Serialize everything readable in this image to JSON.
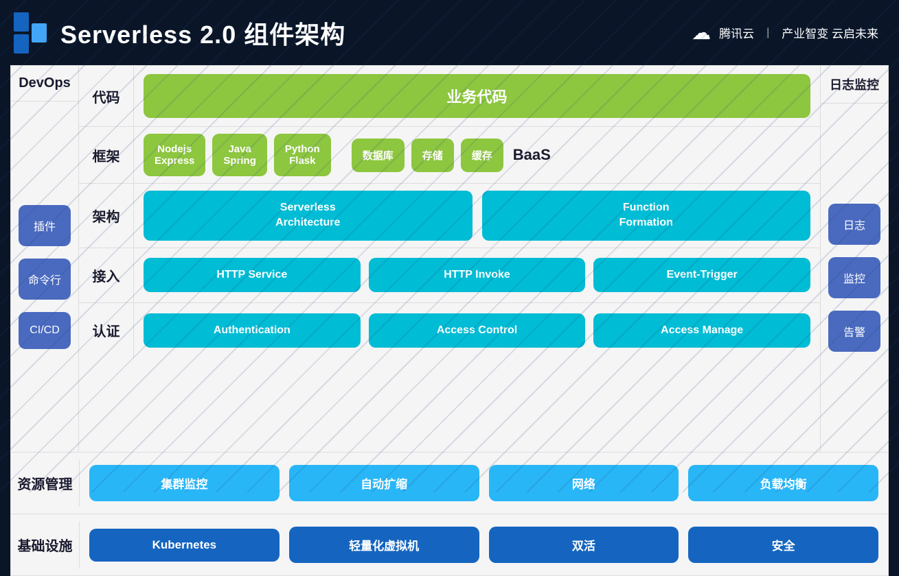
{
  "header": {
    "title": "Serverless 2.0 组件架构",
    "brand": "腾讯云",
    "divider": "|",
    "slogan": "产业智变 云启未来"
  },
  "sidebar_left": {
    "header": "DevOps",
    "items": [
      {
        "label": "插件"
      },
      {
        "label": "命令行"
      },
      {
        "label": "CI/CD"
      }
    ]
  },
  "sidebar_right": {
    "header": "日志监控",
    "items": [
      {
        "label": "日志"
      },
      {
        "label": "监控"
      },
      {
        "label": "告警"
      }
    ]
  },
  "rows": {
    "code": {
      "label": "代码",
      "business_code": "业务代码"
    },
    "framework": {
      "label": "框架",
      "left_items": [
        {
          "line1": "Nodejs",
          "line2": "Express"
        },
        {
          "line1": "Java",
          "line2": "Spring"
        },
        {
          "line1": "Python",
          "line2": "Flask"
        }
      ],
      "right_items": [
        {
          "label": "数据库"
        },
        {
          "label": "存储"
        },
        {
          "label": "缓存"
        }
      ],
      "baas_label": "BaaS"
    },
    "arch": {
      "label": "架构",
      "items": [
        {
          "line1": "Serverless",
          "line2": "Architecture"
        },
        {
          "line1": "Function",
          "line2": "Formation"
        }
      ]
    },
    "access": {
      "label": "接入",
      "items": [
        {
          "label": "HTTP Service"
        },
        {
          "label": "HTTP Invoke"
        },
        {
          "label": "Event-Trigger"
        }
      ]
    },
    "auth": {
      "label": "认证",
      "items": [
        {
          "label": "Authentication"
        },
        {
          "label": "Access Control"
        },
        {
          "label": "Access Manage"
        }
      ]
    }
  },
  "bottom_rows": {
    "resource": {
      "label": "资源管理",
      "items": [
        {
          "label": "集群监控"
        },
        {
          "label": "自动扩缩"
        },
        {
          "label": "网络"
        },
        {
          "label": "负载均衡"
        }
      ]
    },
    "infra": {
      "label": "基础设施",
      "items": [
        {
          "label": "Kubernetes"
        },
        {
          "label": "轻量化虚拟机"
        },
        {
          "label": "双活"
        },
        {
          "label": "安全"
        }
      ]
    }
  }
}
